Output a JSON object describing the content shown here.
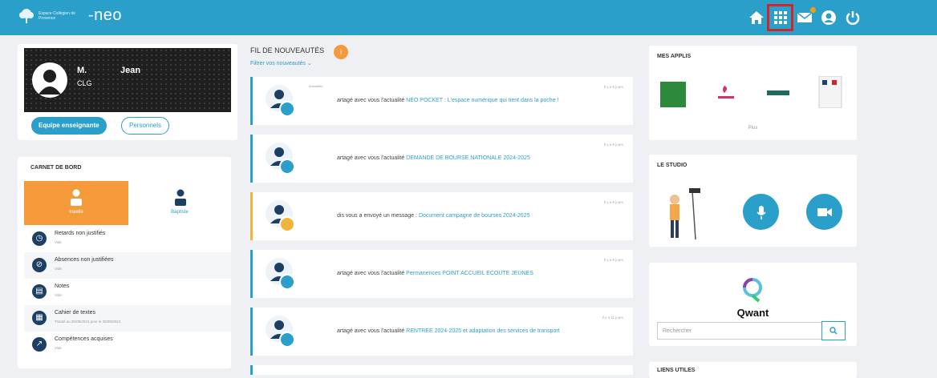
{
  "header": {
    "logo_small_text": "Espace Collégien de Provence",
    "logo_name": "neo",
    "color": "#2a9fc9"
  },
  "profile": {
    "first_name": "M.",
    "last_name": "Jean",
    "class": "CLG",
    "team_button": "Equipe enseignante",
    "staff_button": "Personnels"
  },
  "dashboard": {
    "title": "CARNET DE BORD",
    "tabs": [
      {
        "label": "Inaelle",
        "active": true
      },
      {
        "label": "Baptiste",
        "active": false
      }
    ],
    "rows": [
      {
        "title": "Retards non justifiés",
        "sub": "Vide"
      },
      {
        "title": "Absences non justifiées",
        "sub": "Vide"
      },
      {
        "title": "Notes",
        "sub": "Vide"
      },
      {
        "title": "Cahier de textes",
        "sub": "Travail au 25/09/2024 pour le 26/09/2024"
      },
      {
        "title": "Compétences acquises",
        "sub": "Vide"
      }
    ]
  },
  "feed": {
    "title": "FIL DE NOUVEAUTÉS",
    "badge": "i",
    "filter": "Filtrer vos nouveautés",
    "items": [
      {
        "prefix": "artagé avec vous l'actualité ",
        "link": "NEO POCKET : L'espace numérique qui tient dans la poche !",
        "date": "Il y a 5 jours",
        "small": "Actualités",
        "type": "news"
      },
      {
        "prefix": "artagé avec vous l'actualité ",
        "link": "DEMANDE DE BOURSE NATIONALE 2024-2025",
        "date": "Il y a 6 jours",
        "small": "",
        "type": "news"
      },
      {
        "prefix": "dis vous a envoyé un message : ",
        "link": "Document campagne de bourses 2024-2025",
        "date": "Il y a 6 jours",
        "small": "",
        "type": "message"
      },
      {
        "prefix": "artagé avec vous l'actualité ",
        "link": "Permanences POINT ACCUEIL ECOUTE JEUNES",
        "date": "Il y a 6 jours",
        "small": "",
        "type": "news"
      },
      {
        "prefix": "artagé avec vous l'actualité ",
        "link": "RENTREE 2024-2025 et adaptation des services de transport",
        "date": "Il y a 11 jours",
        "small": "",
        "type": "news"
      }
    ]
  },
  "apps": {
    "title": "MES APPLIS",
    "plus": "Plus"
  },
  "studio": {
    "title": "LE STUDIO"
  },
  "qwant": {
    "logo": "Qwant",
    "placeholder": "Rechercher"
  },
  "links": {
    "title": "LIENS UTILES"
  }
}
